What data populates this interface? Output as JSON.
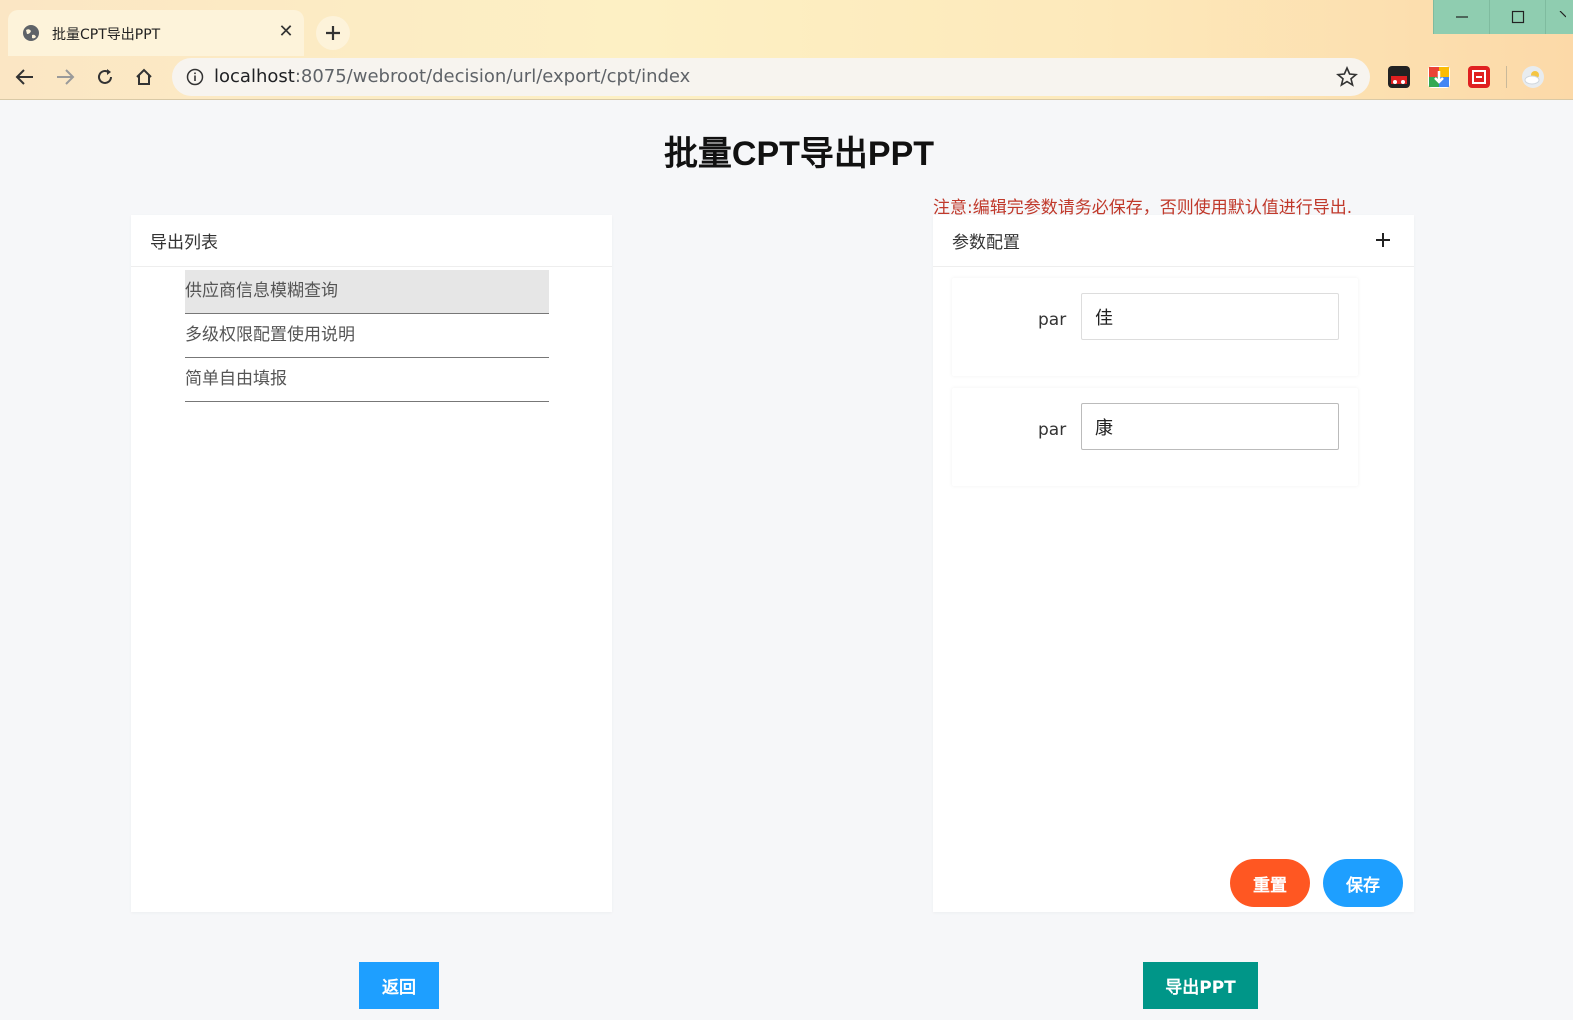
{
  "browser": {
    "tab_title": "批量CPT导出PPT",
    "tab_close": "✕",
    "url_host": "localhost",
    "url_rest": ":8075/webroot/decision/url/export/cpt/index",
    "icons": [
      "globe-icon",
      "back-icon",
      "forward-icon",
      "reload-icon",
      "home-icon",
      "info-icon",
      "star-icon"
    ]
  },
  "page": {
    "title": "批量CPT导出PPT",
    "notice": "注意:编辑完参数请务必保存，否则使用默认值进行导出."
  },
  "export_list": {
    "header": "导出列表",
    "items": [
      {
        "label": "供应商信息模糊查询",
        "selected": true
      },
      {
        "label": "多级权限配置使用说明",
        "selected": false
      },
      {
        "label": "简单自由填报",
        "selected": false
      }
    ]
  },
  "param_config": {
    "header": "参数配置",
    "params": [
      {
        "label": "par",
        "value": "佳"
      },
      {
        "label": "par",
        "value": "康"
      }
    ],
    "reset_label": "重置",
    "save_label": "保存"
  },
  "footer": {
    "back_label": "返回",
    "export_label": "导出PPT"
  },
  "colors": {
    "notice": "#c0392b",
    "reset": "#ff5722",
    "save": "#1e9fff",
    "back": "#1e9fff",
    "export": "#009688"
  }
}
